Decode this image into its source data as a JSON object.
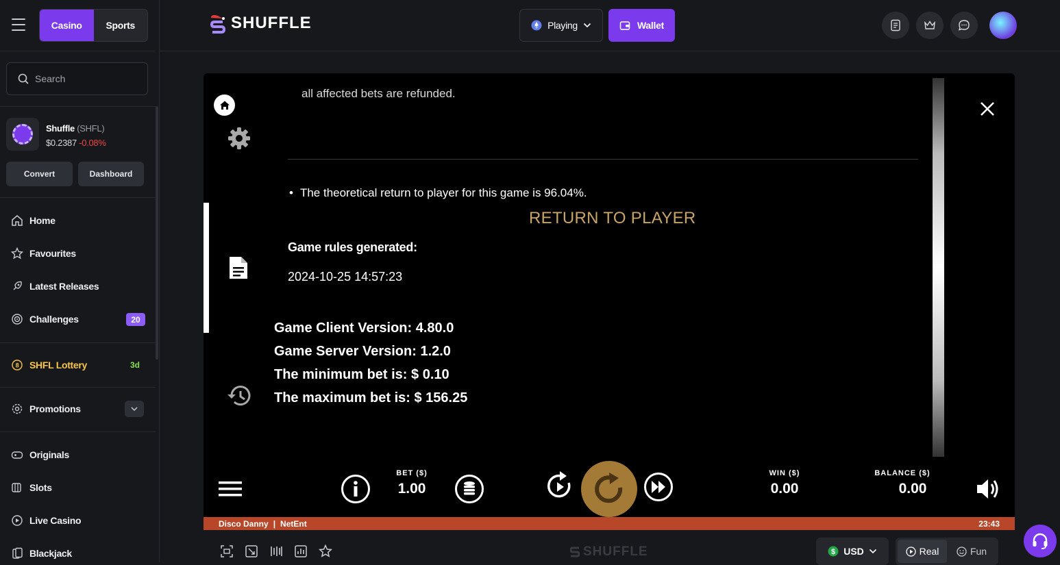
{
  "sidebar": {
    "tabs": [
      "Casino",
      "Sports"
    ],
    "search_placeholder": "Search",
    "token": {
      "name": "Shuffle",
      "symbol": "(SHFL)",
      "price": "$0.2387",
      "change": "-0.08%"
    },
    "convert_label": "Convert",
    "dashboard_label": "Dashboard",
    "nav": [
      {
        "label": "Home",
        "icon": "home-icon"
      },
      {
        "label": "Favourites",
        "icon": "star-icon"
      },
      {
        "label": "Latest Releases",
        "icon": "rocket-icon"
      },
      {
        "label": "Challenges",
        "icon": "target-icon",
        "badge": "20"
      },
      {
        "label": "SHFL Lottery",
        "icon": "lottery-icon",
        "tag": "3d"
      },
      {
        "label": "Promotions",
        "icon": "gear-badge-icon"
      },
      {
        "label": "Originals",
        "icon": "gamepad-icon"
      },
      {
        "label": "Slots",
        "icon": "slots-icon"
      },
      {
        "label": "Live Casino",
        "icon": "live-icon"
      },
      {
        "label": "Blackjack",
        "icon": "cards-icon"
      }
    ]
  },
  "header": {
    "logo_text": "SHUFFLE",
    "playing_label": "Playing",
    "wallet_label": "Wallet"
  },
  "game": {
    "refund_text": "all affected bets are refunded.",
    "rtp_heading": "RETURN TO PLAYER",
    "rtp_bullet": "The theoretical return to player for this game is 96.04%.",
    "rules_generated_label": "Game rules generated:",
    "rules_generated_value": "2024-10-25 14:57:23",
    "client_version": "Game Client Version: 4.80.0",
    "server_version": "Game Server Version: 1.2.0",
    "min_bet": "The minimum bet is: $ 0.10",
    "max_bet": "The maximum bet is: $ 156.25",
    "bet_label": "BET ($)",
    "bet_value": "1.00",
    "win_label": "WIN ($)",
    "win_value": "0.00",
    "balance_label": "BALANCE ($)",
    "balance_value": "0.00",
    "game_name": "Disco Danny",
    "provider": "NetEnt",
    "clock": "23:43"
  },
  "toolbar": {
    "logo_text": "SHUFFLE",
    "currency": "USD",
    "real_label": "Real",
    "fun_label": "Fun"
  },
  "colors": {
    "accent": "#7c3aed",
    "gold": "#c8a467",
    "footer": "#b8472a"
  }
}
